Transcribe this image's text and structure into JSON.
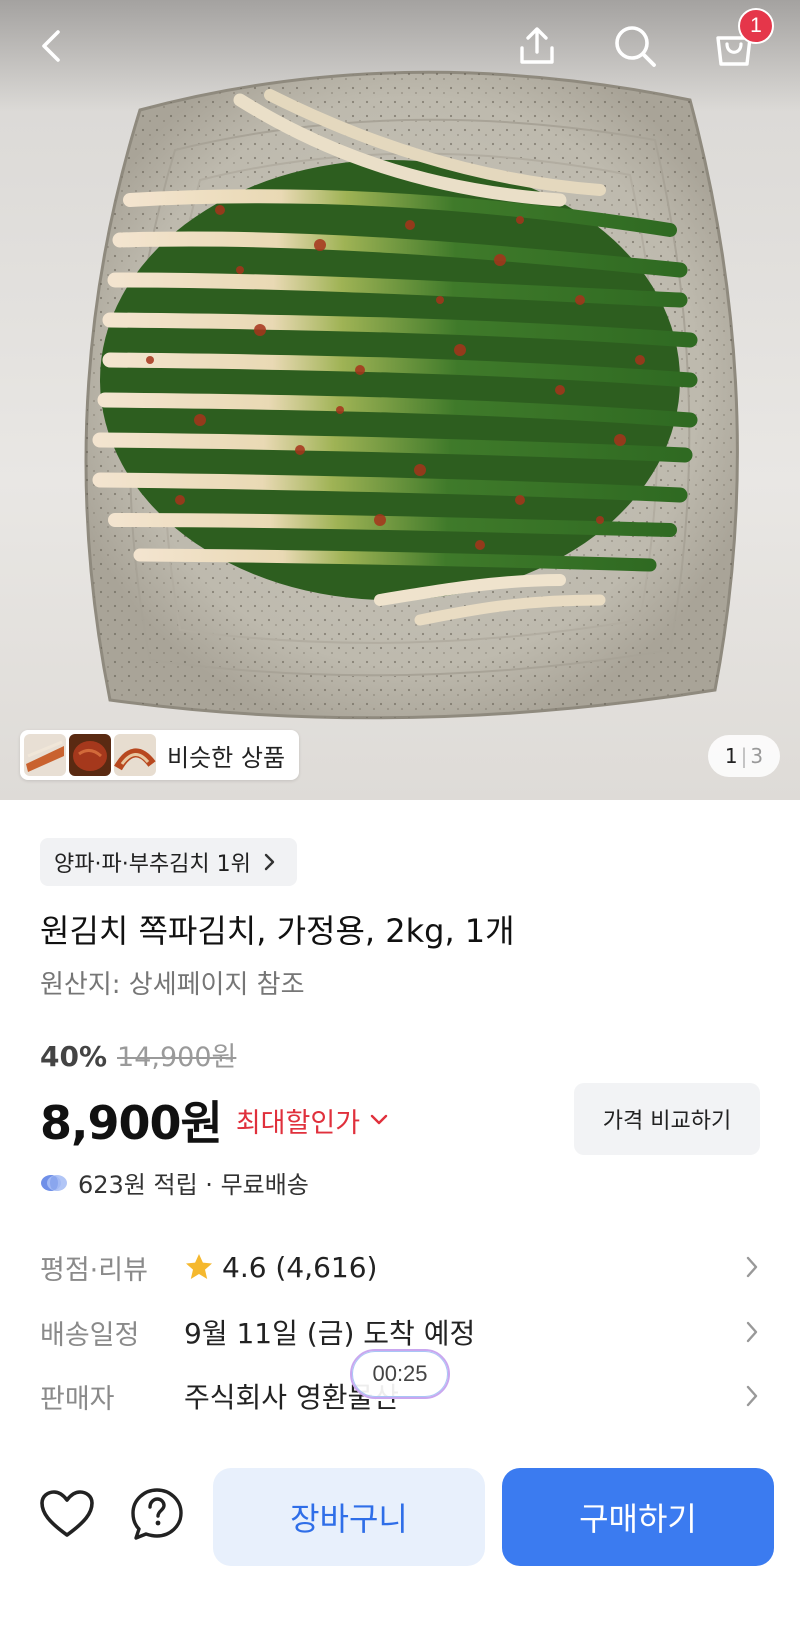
{
  "header": {
    "back_icon": "chevron-left-icon",
    "share_icon": "share-icon",
    "search_icon": "search-icon",
    "cart_icon": "cart-icon",
    "cart_badge": "1"
  },
  "gallery": {
    "similar_label": "비슷한 상품",
    "page_current": "1",
    "page_sep": "|",
    "page_total": "3"
  },
  "product": {
    "rank_chip": "양파·파·부추김치 1위",
    "title": "원김치 쪽파김치, 가정용, 2kg, 1개",
    "origin": "원산지: 상세페이지 참조",
    "discount_percent": "40%",
    "original_price": "14,900원",
    "price": "8,900원",
    "max_discount_label": "최대할인가",
    "compare_button": "가격 비교하기",
    "reward_text": "623원 적립 · 무료배송"
  },
  "info_rows": {
    "rating_label": "평점·리뷰",
    "rating_value": "4.6 (4,616)",
    "delivery_label": "배송일정",
    "delivery_value": "9월 11일 (금) 도착 예정",
    "seller_label": "판매자",
    "seller_value": "주식회사 영환물산"
  },
  "overlay": {
    "timer": "00:25"
  },
  "bottom_bar": {
    "cart_button": "장바구니",
    "buy_button": "구매하기"
  },
  "colors": {
    "accent_blue": "#3b7bf0",
    "discount_red": "#e0303c",
    "badge_red": "#e5364a",
    "star_yellow": "#f5b82e"
  }
}
